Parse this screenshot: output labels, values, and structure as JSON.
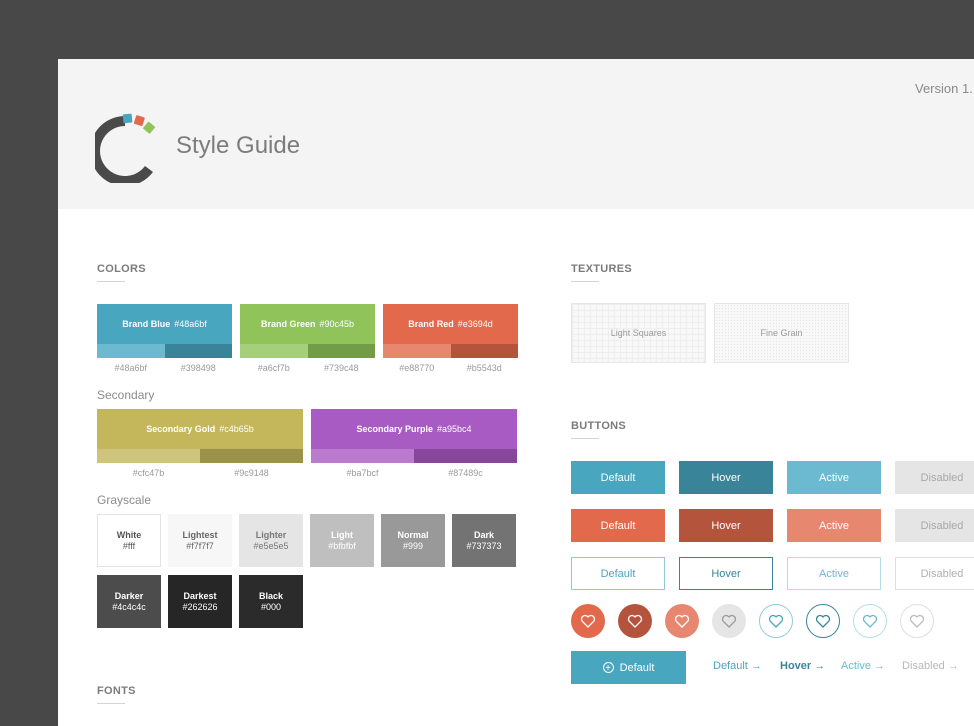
{
  "header": {
    "version": "Version 1.",
    "title": "Style Guide"
  },
  "colors": {
    "heading": "COLORS",
    "brand": [
      {
        "name": "Brand Blue",
        "hex": "#48a6bf",
        "light": "#48a6bf",
        "dark": "#398498",
        "light_color": "#6bbad0",
        "dark_color": "#398498"
      },
      {
        "name": "Brand Green",
        "hex": "#90c45b",
        "light": "#a6cf7b",
        "dark": "#739c48",
        "light_color": "#a6cf7b",
        "dark_color": "#739c48"
      },
      {
        "name": "Brand Red",
        "hex": "#e3694d",
        "light": "#e88770",
        "dark": "#b5543d",
        "light_color": "#e88770",
        "dark_color": "#b5543d"
      }
    ],
    "secondary_label": "Secondary",
    "secondary": [
      {
        "name": "Secondary Gold",
        "hex": "#c4b65b",
        "light": "#cfc47b",
        "dark": "#9c9148",
        "light_color": "#cfc47b",
        "dark_color": "#9c9148"
      },
      {
        "name": "Secondary Purple",
        "hex": "#a95bc4",
        "light": "#ba7bcf",
        "dark": "#87489c",
        "light_color": "#ba7bcf",
        "dark_color": "#87489c"
      }
    ],
    "grayscale_label": "Grayscale",
    "grayscale": [
      {
        "name": "White",
        "hex": "#fff",
        "bg": "#ffffff",
        "fg": "#555555",
        "border": "#e3e3e3"
      },
      {
        "name": "Lightest",
        "hex": "#f7f7f7",
        "bg": "#f7f7f7",
        "fg": "#666666",
        "border": "#f7f7f7"
      },
      {
        "name": "Lighter",
        "hex": "#e5e5e5",
        "bg": "#e5e5e5",
        "fg": "#777777",
        "border": "#e5e5e5"
      },
      {
        "name": "Light",
        "hex": "#bfbfbf",
        "bg": "#bfbfbf",
        "fg": "#ffffff",
        "border": "#bfbfbf"
      },
      {
        "name": "Normal",
        "hex": "#999",
        "bg": "#999999",
        "fg": "#ffffff",
        "border": "#999999"
      },
      {
        "name": "Dark",
        "hex": "#737373",
        "bg": "#737373",
        "fg": "#ffffff",
        "border": "#737373"
      },
      {
        "name": "Darker",
        "hex": "#4c4c4c",
        "bg": "#4c4c4c",
        "fg": "#ffffff",
        "border": "#4c4c4c"
      },
      {
        "name": "Darkest",
        "hex": "#262626",
        "bg": "#262626",
        "fg": "#ffffff",
        "border": "#262626"
      },
      {
        "name": "Black",
        "hex": "#000",
        "bg": "#2b2b2b",
        "fg": "#ffffff",
        "border": "#2b2b2b"
      }
    ]
  },
  "fonts": {
    "heading": "FONTS"
  },
  "textures": {
    "heading": "TEXTURES",
    "items": [
      "Light Squares",
      "Fine Grain"
    ]
  },
  "buttons": {
    "heading": "BUTTONS",
    "states": [
      "Default",
      "Hover",
      "Active",
      "Disabled"
    ],
    "icon_button_label": "Default",
    "links": [
      "Default",
      "Hover",
      "Active",
      "Disabled"
    ],
    "arrow": "→"
  }
}
